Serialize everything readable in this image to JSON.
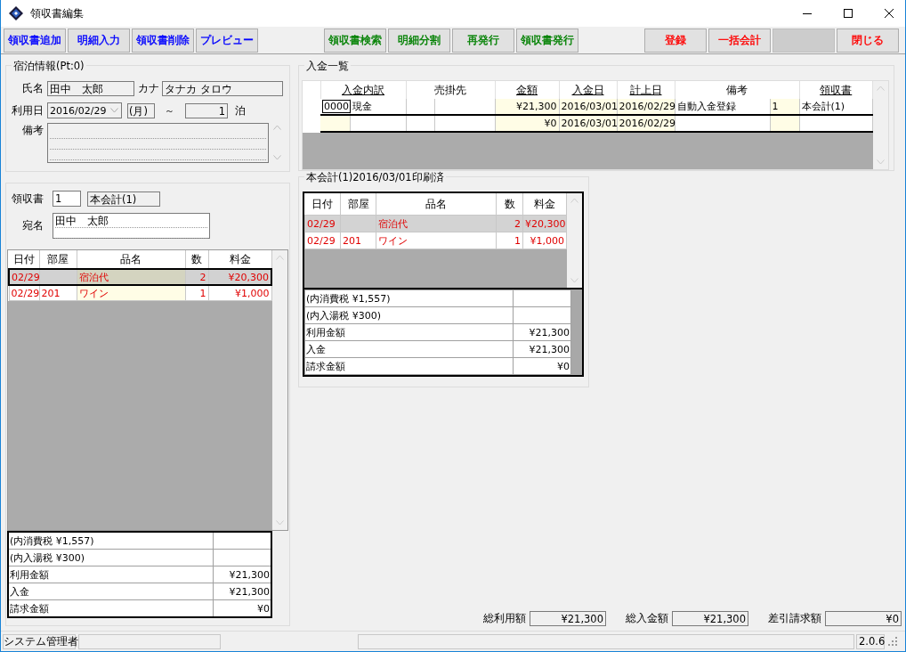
{
  "window": {
    "title": "領収書編集"
  },
  "toolbar": [
    {
      "label": "領収書追加",
      "color": "#0000ff"
    },
    {
      "label": "明細入力",
      "color": "#0000ff"
    },
    {
      "label": "領収書削除",
      "color": "#0000ff"
    },
    {
      "label": "プレビュー",
      "color": "#0000ff"
    },
    {
      "label": "領収書検索",
      "color": "#008000"
    },
    {
      "label": "明細分割",
      "color": "#008000"
    },
    {
      "label": "再発行",
      "color": "#008000"
    },
    {
      "label": "領収書発行",
      "color": "#008000"
    },
    {
      "label": "登録",
      "color": "#ff0000"
    },
    {
      "label": "一括会計",
      "color": "#ff0000"
    },
    {
      "kind": "blank"
    },
    {
      "label": "閉じる",
      "color": "#ff0000"
    }
  ],
  "stay": {
    "legend": "宿泊情報(Pt:0)",
    "name_label": "氏名",
    "name": "田中　太郎",
    "kana_label": "カナ",
    "kana": "タナカ タロウ",
    "date_label": "利用日",
    "date": "2016/02/29",
    "weekday": "(月)",
    "tilde": "～",
    "nights": "1",
    "nights_unit": "泊",
    "memo_label": "備考"
  },
  "receipt": {
    "number_label": "領収書",
    "number": "1",
    "account": "本会計(1)",
    "addressee_label": "宛名",
    "addressee": "田中　太郎",
    "columns": [
      "日付",
      "部屋",
      "品名",
      "数",
      "料金"
    ],
    "items": [
      {
        "date": "02/29",
        "item": "宿泊代",
        "qty": "2",
        "price": "¥20,300",
        "selected": true
      },
      {
        "date": "02/29",
        "room": "201",
        "item": "ワイン",
        "qty": "1",
        "price": "¥1,000",
        "selected": false
      }
    ],
    "summary": [
      {
        "label": "(内消費税 ¥1,557)"
      },
      {
        "label": "(内入湯税 ¥300)"
      },
      {
        "label": "利用金額",
        "value": "¥21,300"
      },
      {
        "label": "入金",
        "value": "¥21,300"
      },
      {
        "label": "請求金額",
        "value": "¥0"
      }
    ]
  },
  "payments": {
    "legend": "入金一覧",
    "columns": [
      {
        "label": "入金内訳",
        "underlined": true
      },
      {
        "label": "売掛先",
        "underlined": false
      },
      {
        "label": "金額",
        "underlined": true
      },
      {
        "label": "入金日",
        "underlined": true
      },
      {
        "label": "計上日",
        "underlined": true
      },
      {
        "label": "備考",
        "underlined": false
      },
      {
        "label": "領収書",
        "underlined": true
      }
    ],
    "rows": [
      {
        "code": "0000",
        "method": "現金",
        "amount": "¥21,300",
        "paid_on": "2016/03/01",
        "booked_on": "2016/02/29",
        "memo": "自動入金登録",
        "memo_no": "1",
        "receipt": "本会計(1)",
        "current": false
      },
      {
        "amount": "¥0",
        "paid_on": "2016/03/01",
        "booked_on": "2016/02/29",
        "current": true
      }
    ]
  },
  "printed": {
    "legend": "本会計(1)2016/03/01印刷済",
    "columns": [
      "日付",
      "部屋",
      "品名",
      "数",
      "料金"
    ],
    "items": [
      {
        "date": "02/29",
        "item": "宿泊代",
        "qty": "2",
        "price": "¥20,300",
        "selected": true
      },
      {
        "date": "02/29",
        "room": "201",
        "item": "ワイン",
        "qty": "1",
        "price": "¥1,000",
        "selected": false
      }
    ],
    "summary": [
      {
        "label": "(内消費税 ¥1,557)"
      },
      {
        "label": "(内入湯税 ¥300)"
      },
      {
        "label": "利用金額",
        "value": "¥21,300"
      },
      {
        "label": "入金",
        "value": "¥21,300"
      },
      {
        "label": "請求金額",
        "value": "¥0"
      }
    ]
  },
  "totals": [
    {
      "label": "総利用額",
      "value": "¥21,300"
    },
    {
      "label": "総入金額",
      "value": "¥21,300"
    },
    {
      "label": "差引請求額",
      "value": "¥0"
    }
  ],
  "status_bar": {
    "user": "システム管理者",
    "version": "2.0.6"
  }
}
